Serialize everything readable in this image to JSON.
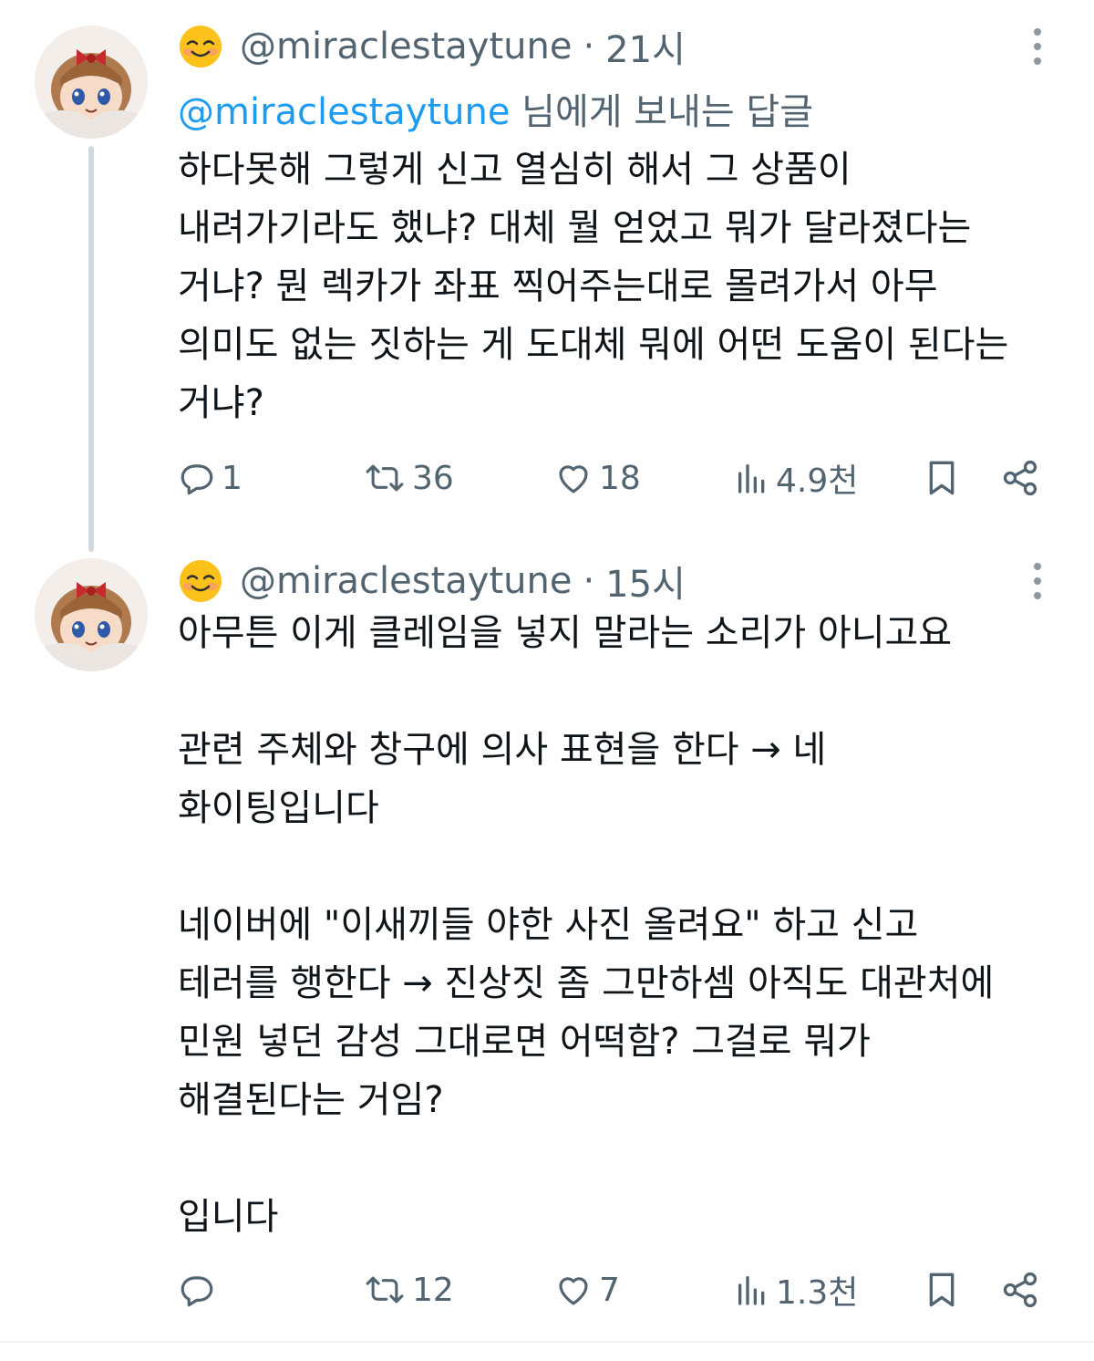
{
  "tweets": [
    {
      "handle": "@miraclestaytune",
      "separator": "·",
      "time": "21시",
      "reply_to": {
        "mention": "@miraclestaytune",
        "suffix": " 님에게 보내는 답글"
      },
      "text": "하다못해 그렇게 신고 열심히 해서 그 상품이\n내려가기라도 했냐? 대체 뭘 얻었고 뭐가 달라졌다는\n거냐? 뭔 렉카가 좌표 찍어주는대로 몰려가서 아무\n의미도 없는 짓하는 게 도대체 뭐에 어떤 도움이 된다는\n거냐?",
      "stats": {
        "replies": "1",
        "retweets": "36",
        "likes": "18",
        "views": "4.9천"
      }
    },
    {
      "handle": "@miraclestaytune",
      "separator": "·",
      "time": "15시",
      "text": "아무튼 이게 클레임을 넣지 말라는 소리가 아니고요\n\n관련 주체와 창구에 의사 표현을 한다 → 네\n화이팅입니다\n\n네이버에 \"이새끼들 야한 사진 올려요\" 하고 신고\n테러를 행한다 → 진상짓 좀 그만하셈 아직도 대관처에\n민원 넣던 감성 그대로면 어떡함? 그걸로 뭐가\n해결된다는 거임?\n\n입니다",
      "stats": {
        "replies": "",
        "retweets": "12",
        "likes": "7",
        "views": "1.3천"
      }
    }
  ],
  "icons": {
    "emoji": "smiling-face-emoji",
    "reply": "speech-bubble-icon",
    "retweet": "retweet-arrows-icon",
    "like": "heart-icon",
    "views": "bar-chart-icon",
    "bookmark": "bookmark-icon",
    "share": "share-nodes-icon",
    "more": "vertical-dots-icon"
  },
  "colors": {
    "text": "#0f1419",
    "secondary": "#536471",
    "link": "#1d9bf0",
    "thread_line": "#cfd9de"
  }
}
